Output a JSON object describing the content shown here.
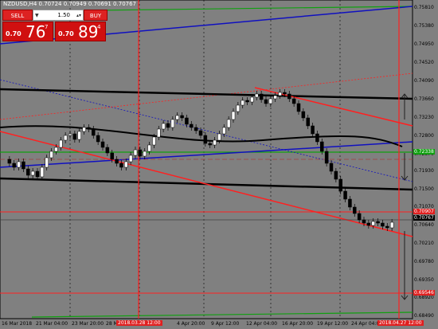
{
  "chart_title": "NZDUSD,H4  0.70724 0.70949 0.70691 0.70767",
  "panel": {
    "sell_label": "SELL",
    "buy_label": "BUY",
    "lot_value": "1.50",
    "sell_small": "0.70",
    "sell_big": "76",
    "sell_sup": "7",
    "buy_small": "0.70",
    "buy_big": "89",
    "buy_sup": "4"
  },
  "y_axis": [
    "0.75810",
    "0.75380",
    "0.74950",
    "0.74520",
    "0.74090",
    "0.73660",
    "0.73230",
    "0.72800",
    "0.72370",
    "0.71930",
    "0.71500",
    "0.71070",
    "0.70640",
    "0.70210",
    "0.69780",
    "0.69350",
    "0.68920",
    "0.68490"
  ],
  "y_tags": {
    "tag_high": "0.72338",
    "tag_mid1": "0.70907",
    "tag_mid2": "0.70767",
    "tag_low": "0.69546"
  },
  "x_axis": [
    "16 Mar 2018",
    "21 Mar 04:00",
    "23 Mar 20:00",
    "28 Mar",
    "4 Apr 20:00",
    "9 Apr 12:00",
    "12 Apr 04:00",
    "16 Apr 20:00",
    "19 Apr 12:00",
    "24 Apr 04:00"
  ],
  "x_tags": {
    "tag1": "2018.03.28 12:00",
    "tag2": "2018.04.27 12:00"
  },
  "colors": {
    "background": "#808080",
    "bull": "#ffffff",
    "bear": "#000000",
    "trend_red": "#ff2020",
    "trend_blue": "#1010c0",
    "trend_green": "#10a010",
    "level_black": "#000000"
  },
  "chart_data": {
    "type": "candlestick",
    "symbol": "NZDUSD",
    "timeframe": "H4",
    "ylim": [
      0.6849,
      0.7581
    ]
  }
}
